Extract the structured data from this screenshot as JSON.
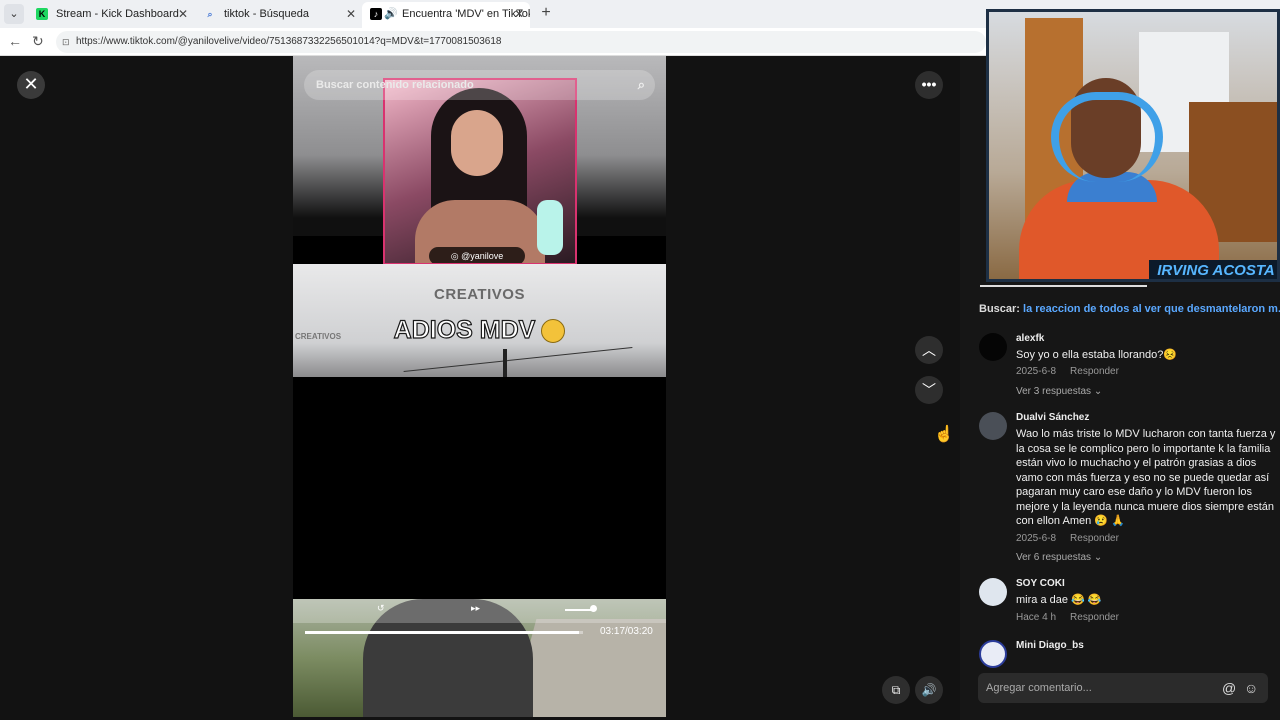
{
  "browser": {
    "tabs": [
      {
        "title": "Stream - Kick Dashboard",
        "favicon": "K"
      },
      {
        "title": "tiktok - Búsqueda",
        "favicon": "search-icon"
      },
      {
        "title": "Encuentra 'MDV' en TikTok | B",
        "favicon": "tiktok-icon"
      }
    ],
    "url": "https://www.tiktok.com/@yanilovelive/video/7513687332256501014?q=MDV&t=1770081503618"
  },
  "video": {
    "search_placeholder": "Buscar contenido relacionado",
    "handle": "@yanilove",
    "brand": "CREATIVOS",
    "headline": "ADIOS MDV",
    "time": "03:17/03:20",
    "progress": 0.985
  },
  "comments": {
    "search_label": "Buscar:",
    "search_query": "la reaccion de todos al ver que desmantelaron m...",
    "items": [
      {
        "user": "alexfk",
        "text": "Soy yo o ella estaba llorando?😣",
        "date": "2025-6-8",
        "reply": "Responder",
        "replies": "Ver 3 respuestas ⌄"
      },
      {
        "user": "Dualvi Sánchez",
        "text": "Wao lo más triste lo MDV lucharon con tanta fuerza y la cosa se le complico pero lo importante k la familia están vivo lo muchacho y el patrón grasias a dios vamo con más fuerza y eso no se puede quedar así pagaran muy caro ese daño y lo MDV fueron los mejore y la leyenda nunca muere dios siempre están con ellon Amen 😢 🙏",
        "date": "2025-6-8",
        "reply": "Responder",
        "replies": "Ver 6 respuestas ⌄"
      },
      {
        "user": "SOY COKI",
        "text": "mira a dae 😂 😂",
        "date": "Hace 4 h",
        "reply": "Responder",
        "replies": ""
      },
      {
        "user": "Mini Diago_bs",
        "text": "",
        "date": "",
        "reply": "",
        "replies": ""
      }
    ],
    "input_placeholder": "Agregar comentario..."
  },
  "streamer": {
    "name": "IRVING ACOSTA"
  }
}
